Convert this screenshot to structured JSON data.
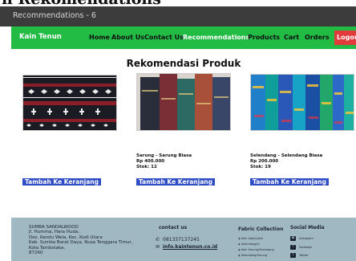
{
  "page_heading": "n Rekomendations",
  "window": {
    "title": "Recommendations - 6"
  },
  "navbar": {
    "brand": "Kain Tenun",
    "links": [
      {
        "label": "Home",
        "active": false
      },
      {
        "label": "About Us",
        "active": false
      },
      {
        "label": "Contact Us",
        "active": false
      },
      {
        "label": "Recommendations",
        "active": true
      },
      {
        "label": "Products",
        "active": false
      },
      {
        "label": "Cart",
        "active": false
      },
      {
        "label": "Orders",
        "active": false
      }
    ],
    "logout": "Logou"
  },
  "main": {
    "title": "Rekomendasi Produk",
    "products": [
      {
        "name": "",
        "price": "",
        "stock": "",
        "button": "Tambah Ke Keranjang"
      },
      {
        "name": "Sarung - Sarung Biasa",
        "price": "Rp 400.000",
        "stock": "Stok: 12",
        "button": "Tambah Ke Keranjang"
      },
      {
        "name": "Selendang - Selendang Biasa",
        "price": "Rp 200.000",
        "stock": "Stok: 19",
        "button": "Tambah Ke Keranjang"
      }
    ]
  },
  "footer": {
    "address_lines": [
      "SUMBA SANDALWOOD",
      "Jl. Humma, Hara Huda,",
      "Des. Kendu Wela, Kec. Kodi Utara",
      "Kab. Sumba Barat Daya, Nusa Tenggara Timur,",
      "Kota Tambolaka,",
      "87260"
    ],
    "contact_title": "contact us",
    "phone": "081337137245",
    "email": "info.kaintenun.co.id",
    "fabric_title": "Fabric Collection",
    "fabric_items": [
      "Kain Adat/Lokal",
      "Selendang/ln",
      "Kain Sarung/Selendang",
      "Selendang/Sarung"
    ],
    "social_title": "Social Media",
    "social_items": [
      "Instagram",
      "Facebook",
      "Twitter"
    ]
  },
  "colors": {
    "navbar": "#22bb44",
    "logout": "#e23b3b",
    "button": "#2f4dc4",
    "footer": "#9fb8c1",
    "titlebar": "#3c3c3c"
  }
}
